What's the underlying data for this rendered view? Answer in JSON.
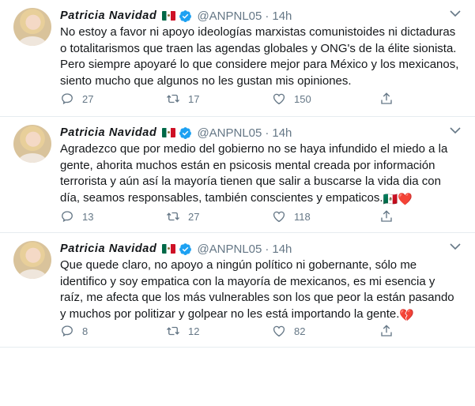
{
  "tweets": [
    {
      "author_name": "Patricia Navidad",
      "handle": "@ANPNL05",
      "separator": "·",
      "time": "14h",
      "flag_icon": "mexico-flag-emoji",
      "text": "No estoy a favor ni apoyo ideologías marxistas comunistoides ni dictaduras o totalitarismos que traen las agendas globales y ONG's de la élite sionista. Pero siempre apoyaré lo que considere mejor para México y los mexicanos, siento mucho que algunos no les gustan mis opiniones.",
      "trailing_emoji": "",
      "replies": "27",
      "retweets": "17",
      "likes": "150"
    },
    {
      "author_name": "Patricia Navidad",
      "handle": "@ANPNL05",
      "separator": "·",
      "time": "14h",
      "flag_icon": "mexico-flag-emoji",
      "text": "Agradezco que por medio del gobierno no se haya infundido el miedo a la gente, ahorita muchos están en psicosis mental creada por información terrorista y aún así la mayoría tienen que salir a buscarse la vida dia con día, seamos responsables, también conscientes y empaticos.",
      "trailing_emoji": "🇲🇽❤️",
      "replies": "13",
      "retweets": "27",
      "likes": "118"
    },
    {
      "author_name": "Patricia Navidad",
      "handle": "@ANPNL05",
      "separator": "·",
      "time": "14h",
      "flag_icon": "mexico-flag-emoji",
      "text": "Que quede claro, no apoyo a ningún político ni gobernante, sólo me identifico y soy empatica con la mayoría de mexicanos, es mi esencia y raíz, me afecta que los más vulnerables son los que peor la están pasando y muchos por politizar y golpear no les está importando la gente.",
      "trailing_emoji": "💔",
      "replies": "8",
      "retweets": "12",
      "likes": "82"
    }
  ],
  "colors": {
    "text": "#14171a",
    "secondary": "#657786",
    "verified_blue": "#1da1f2",
    "divider": "#e6ecf0",
    "heart_red": "#e0245e"
  }
}
